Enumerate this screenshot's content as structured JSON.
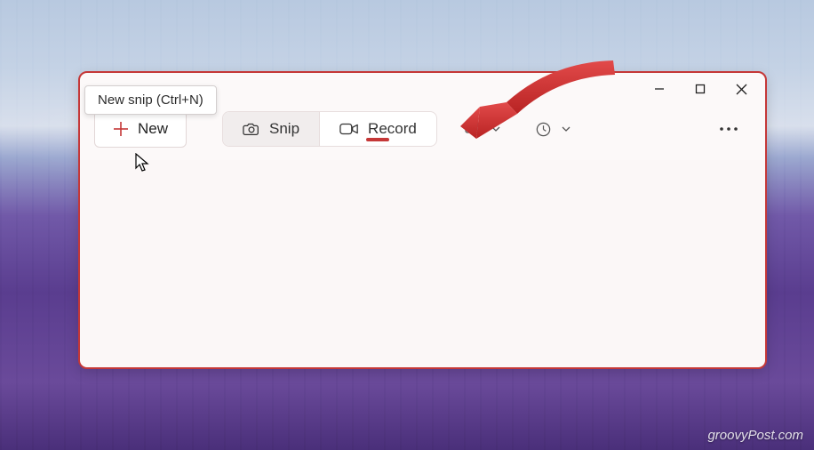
{
  "tooltip": {
    "text": "New snip (Ctrl+N)"
  },
  "toolbar": {
    "new_label": "New",
    "snip_label": "Snip",
    "record_label": "Record"
  },
  "colors": {
    "accent": "#c53737"
  },
  "watermark": "groovyPost.com"
}
